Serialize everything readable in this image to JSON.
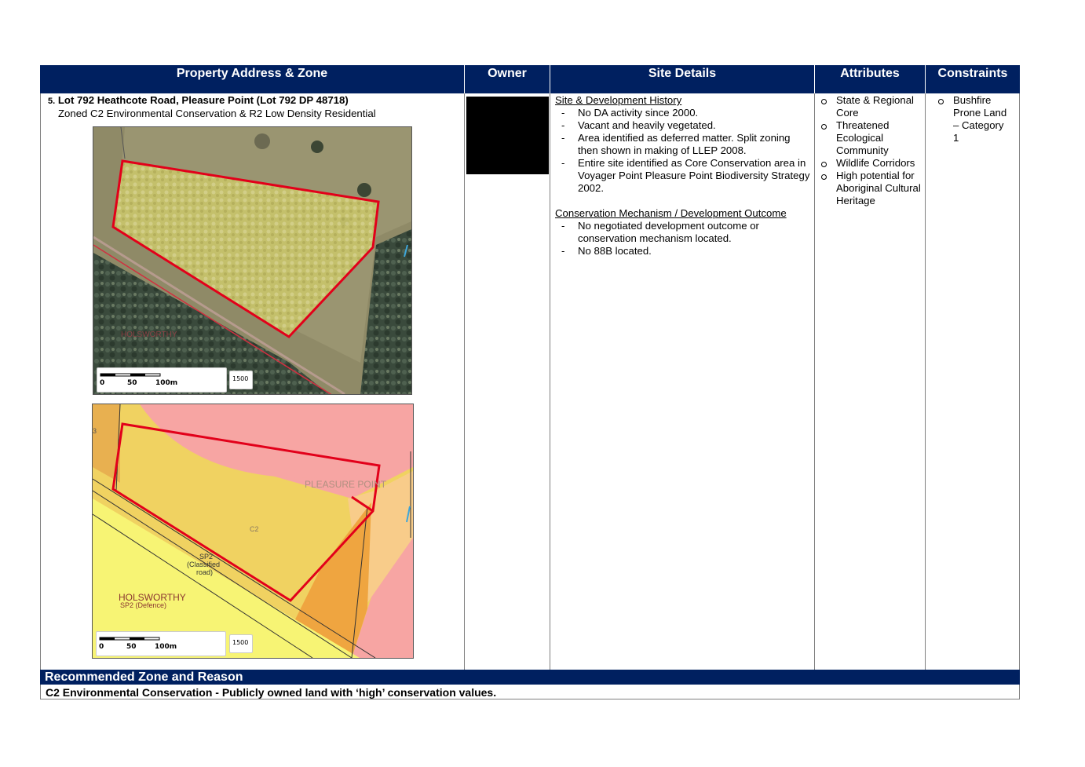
{
  "headers": {
    "address": "Property Address & Zone",
    "owner": "Owner",
    "site": "Site Details",
    "attributes": "Attributes",
    "constraints": "Constraints"
  },
  "property": {
    "number": "5.",
    "title": "Lot 792 Heathcote Road, Pleasure Point (Lot 792 DP 48718)",
    "zoning": "Zoned C2 Environmental Conservation & R2 Low Density Residential"
  },
  "aerial_map": {
    "suburb_label": "HOLSWORTHY",
    "scale": {
      "zero": "0",
      "mid": "50",
      "end": "100m",
      "badge": "1500"
    }
  },
  "zoning_map": {
    "lot_label": "3",
    "suburb_label": "PLEASURE POINT",
    "zone_label": "C2",
    "road_label_1": "SP2",
    "road_label_2": "(Classified",
    "road_label_3": "road)",
    "suburb2_label": "HOLSWORTHY",
    "suburb2_sub": "SP2 (Defence)",
    "scale": {
      "zero": "0",
      "mid": "50",
      "end": "100m",
      "badge": "1500"
    }
  },
  "site_details": {
    "history_heading": "Site & Development History",
    "history_items": [
      "No DA activity since 2000.",
      "Vacant and heavily vegetated.",
      "Area identified as deferred matter. Split zoning then shown in making of LLEP 2008.",
      "Entire site identified as Core Conservation area in Voyager Point Pleasure Point Biodiversity Strategy 2002."
    ],
    "mechanism_heading": "Conservation Mechanism / Development Outcome",
    "mechanism_items": [
      "No negotiated development outcome or conservation mechanism located.",
      "No 88B located."
    ]
  },
  "attributes": [
    "State & Regional Core",
    "Threatened Ecological Community",
    "Wildlife Corridors",
    "High potential for Aboriginal Cultural Heritage"
  ],
  "constraints": [
    "Bushfire Prone Land – Category 1"
  ],
  "recommendation": {
    "heading": "Recommended Zone and Reason",
    "text": "C2 Environmental Conservation - Publicly owned land with ‘high’ conservation values."
  }
}
